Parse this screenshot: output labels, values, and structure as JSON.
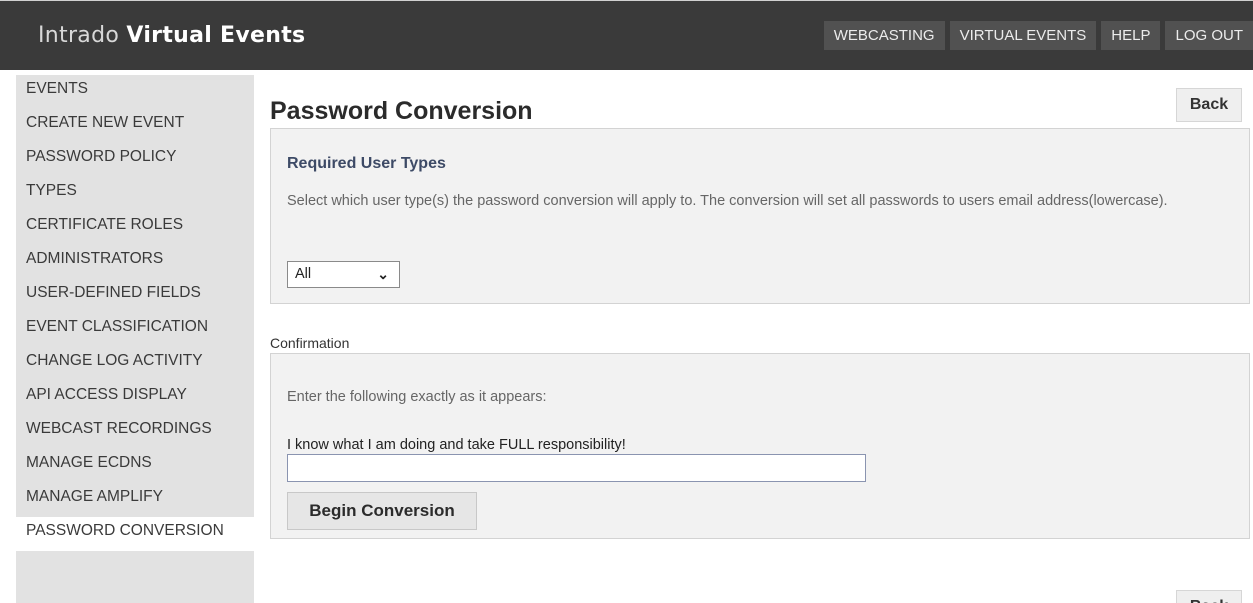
{
  "header": {
    "logo_light": "Intrado ",
    "logo_bold": "Virtual Events",
    "nav": [
      "WEBCASTING",
      "VIRTUAL EVENTS",
      "HELP",
      "LOG OUT"
    ]
  },
  "sidebar": {
    "items": [
      "EVENTS",
      "CREATE NEW EVENT",
      "PASSWORD POLICY",
      "TYPES",
      "CERTIFICATE ROLES",
      "ADMINISTRATORS",
      "USER-DEFINED FIELDS",
      "EVENT CLASSIFICATION",
      "CHANGE LOG ACTIVITY",
      "API ACCESS DISPLAY",
      "WEBCAST RECORDINGS",
      "MANAGE ECDNS",
      "MANAGE AMPLIFY",
      "PASSWORD CONVERSION"
    ],
    "active": "PASSWORD CONVERSION"
  },
  "main": {
    "title": "Password Conversion",
    "back_label": "Back",
    "user_types": {
      "heading": "Required User Types",
      "description": "Select which user type(s) the password conversion will apply to. The conversion will set all passwords to users email address(lowercase).",
      "select_value": "All"
    },
    "confirmation": {
      "label": "Confirmation",
      "instruction": "Enter the following exactly as it appears:",
      "phrase": "I know what I am doing and take FULL responsibility!",
      "input_value": "",
      "button_label": "Begin Conversion"
    }
  },
  "colors": {
    "topbar": "#3a3a3a",
    "sidebar": "#e2e2e2",
    "panel": "#f2f2f2",
    "heading_accent": "#3d4a66"
  }
}
